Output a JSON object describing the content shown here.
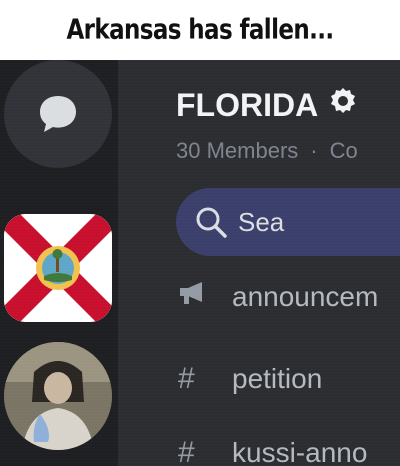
{
  "caption": "Arkansas has fallen...",
  "colors": {
    "rail_bg": "#1e1f22",
    "panel_bg": "#2b2d31",
    "search_bg": "#3b3f6b",
    "title_text": "#f2f3f5",
    "muted_text": "#80848e",
    "flag_red": "#c8102e"
  },
  "rail": {
    "dm_icon": "chat-bubble-icon",
    "server_icon": "florida-flag-icon",
    "avatar_icon": "user-avatar"
  },
  "server": {
    "name": "FLORIDA",
    "badge_icon": "gear-badge-icon",
    "members": "30 Members",
    "separator": "·",
    "meta_extra": "Co"
  },
  "search": {
    "icon": "search-icon",
    "placeholder": "Sea"
  },
  "channels": [
    {
      "icon": "megaphone-icon",
      "name": "announcem"
    },
    {
      "icon": "hash-icon",
      "hash": "#",
      "name": "petition"
    },
    {
      "icon": "hash-icon",
      "hash": "#",
      "name": "kussi-anno"
    }
  ]
}
